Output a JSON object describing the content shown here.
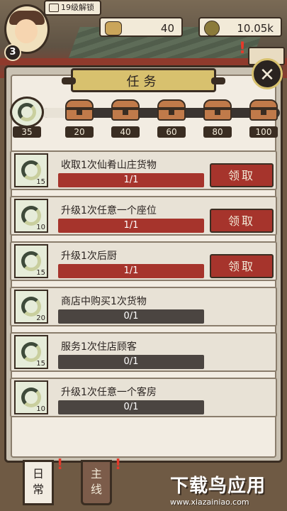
{
  "header": {
    "level": "3",
    "unlock_text": "19级解锁",
    "gold": "40",
    "coins": "10.05k",
    "alert": "!"
  },
  "panel": {
    "title": "任务",
    "close_label": "✕"
  },
  "progress": {
    "current": "35",
    "fraction": 0.12,
    "milestones": [
      "20",
      "40",
      "60",
      "80",
      "100"
    ]
  },
  "quests": [
    {
      "title": "收取1次仙肴山庄货物",
      "reward": "15",
      "progress": "1/1",
      "done": true,
      "claim_label": "领取"
    },
    {
      "title": "升级1次任意一个座位",
      "reward": "10",
      "progress": "1/1",
      "done": true,
      "claim_label": "领取"
    },
    {
      "title": "升级1次后厨",
      "reward": "15",
      "progress": "1/1",
      "done": true,
      "claim_label": "领取"
    },
    {
      "title": "商店中购买1次货物",
      "reward": "20",
      "progress": "0/1",
      "done": false
    },
    {
      "title": "服务1次住店顾客",
      "reward": "15",
      "progress": "0/1",
      "done": false
    },
    {
      "title": "升级1次任意一个客房",
      "reward": "10",
      "progress": "0/1",
      "done": false
    }
  ],
  "tabs": {
    "daily_top": "日",
    "daily_bottom": "常",
    "main_top": "主",
    "main_bottom": "线",
    "alert": "!"
  },
  "watermark": {
    "big": "下载鸟应用",
    "small": "www.xiazainiao.com"
  }
}
